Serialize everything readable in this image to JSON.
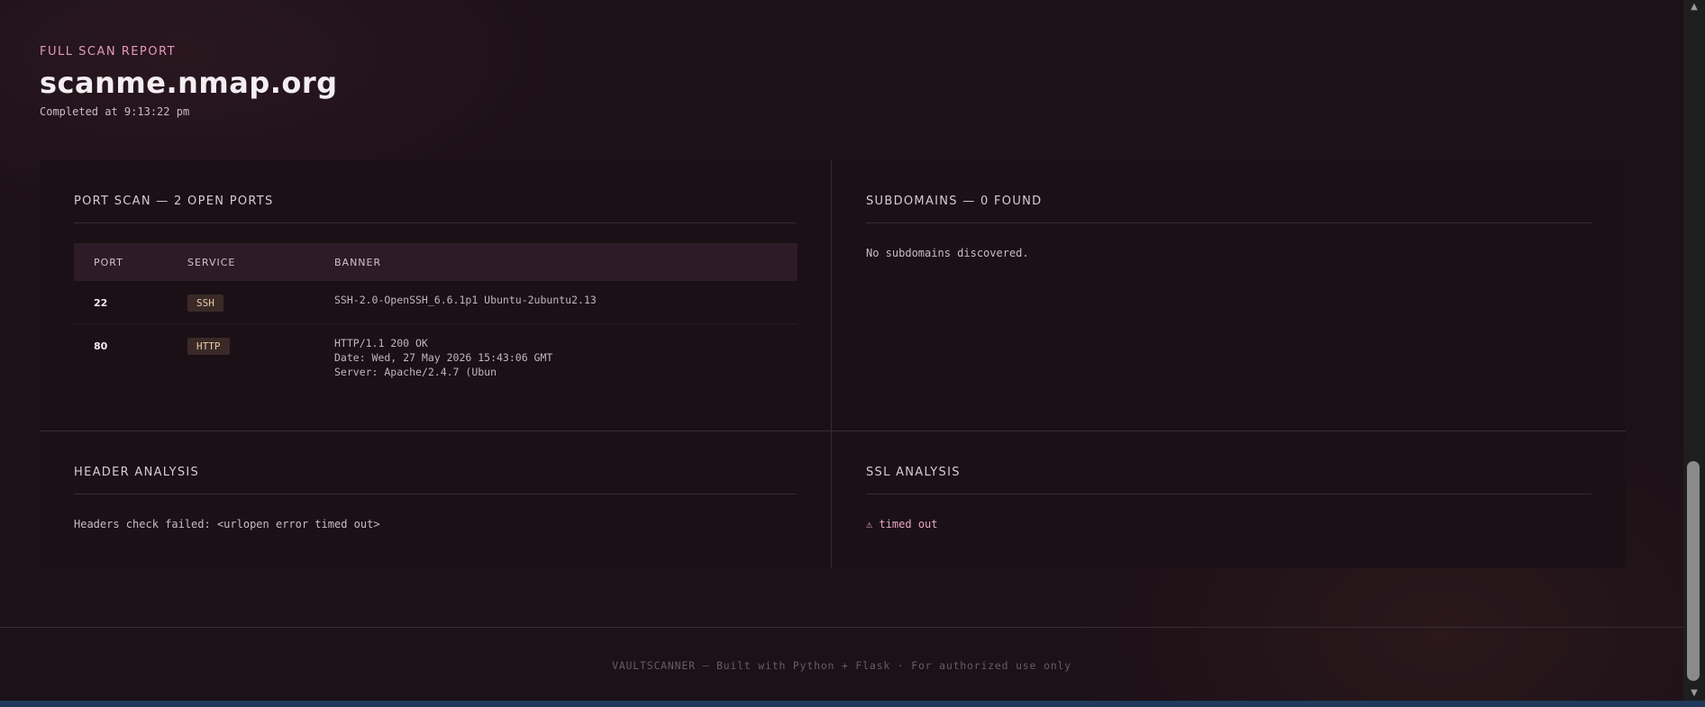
{
  "header": {
    "eyebrow": "FULL SCAN REPORT",
    "title": "scanme.nmap.org",
    "completed": "Completed at 9:13:22 pm"
  },
  "port_scan": {
    "title": "PORT SCAN — 2 OPEN PORTS",
    "columns": [
      "PORT",
      "SERVICE",
      "BANNER"
    ],
    "rows": [
      {
        "port": "22",
        "service": "SSH",
        "banner": [
          "SSH-2.0-OpenSSH_6.6.1p1 Ubuntu-2ubuntu2.13"
        ]
      },
      {
        "port": "80",
        "service": "HTTP",
        "banner": [
          "HTTP/1.1 200 OK",
          "Date: Wed, 27 May 2026 15:43:06 GMT",
          "Server: Apache/2.4.7 (Ubun"
        ]
      }
    ]
  },
  "subdomains": {
    "title": "SUBDOMAINS — 0 FOUND",
    "message": "No subdomains discovered."
  },
  "header_analysis": {
    "title": "HEADER ANALYSIS",
    "message": "Headers check failed: <urlopen error timed out>"
  },
  "ssl_analysis": {
    "title": "SSL ANALYSIS",
    "icon": "warning-icon",
    "icon_glyph": "⚠",
    "message": "timed out"
  },
  "footer": {
    "text": "VAULTSCANNER — Built with Python + Flask  ·  For authorized use only"
  },
  "colors": {
    "accent": "#e39ab8",
    "background": "#1b1117",
    "badge_bg": "#3a2a27",
    "badge_text": "#e9c8a6"
  }
}
